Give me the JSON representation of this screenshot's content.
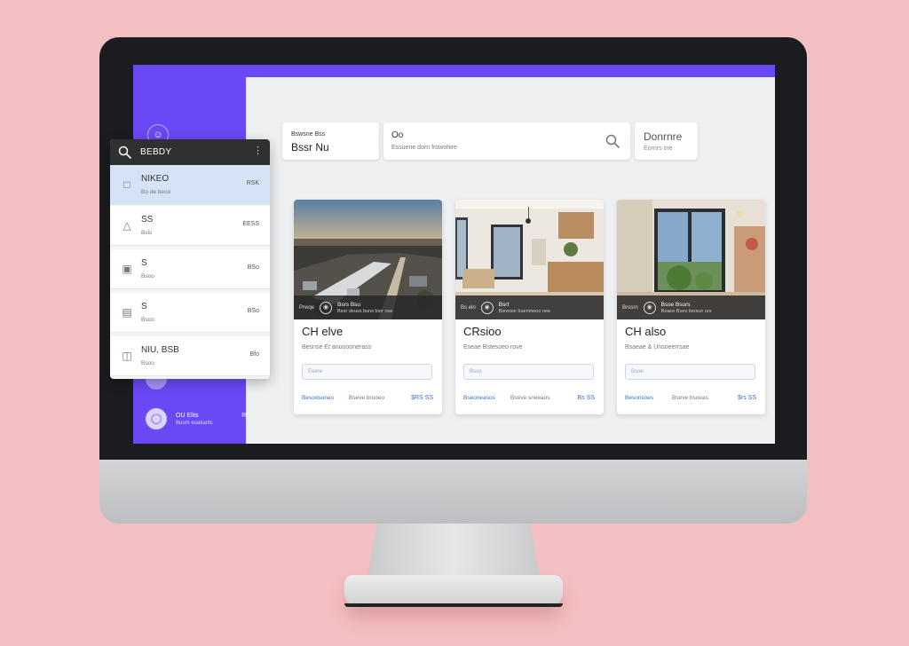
{
  "sidebar": {
    "top_icon": "user-circle-icon",
    "users": [
      {
        "name": "",
        "subtitle": "",
        "count": ""
      },
      {
        "name": "OU Elits",
        "subtitle": "Buum eoatiartls",
        "count": "RS"
      }
    ]
  },
  "search_bar": {
    "location_label": "Bswsne Bss",
    "location_value": "Bssr Nu",
    "query_label": "Oo",
    "query_placeholder": "Essuene dorn frowohire",
    "button_label": "Donrnre",
    "button_sub": "Eornrs ore"
  },
  "cards": [
    {
      "tag": "Prwqe",
      "address_line1": "Bsrs Bsu",
      "address_line2": "Besr deuss buns bsrr ose",
      "title": "CH elve",
      "subtitle": "Besrise Et anoooonerass",
      "field_placeholder": "Eeere",
      "link1": "Besoosuneo",
      "link2": "Bseve bruoeo",
      "price": "$RS SS",
      "scene": "aerial-city"
    },
    {
      "tag": "Bs elo",
      "address_line1": "Bsrt",
      "address_line2": "Bsreose buenmeoo oee",
      "title": "CRsioo",
      "subtitle": "Eseae Bstesoeo rove",
      "field_placeholder": "Bsoe",
      "link1": "Bseoneasos",
      "link2": "Bseve sneeaos",
      "price": "Bs SS",
      "scene": "kitchen-interior"
    },
    {
      "tag": "Brosrn",
      "address_line1": "Bsse Bsurs",
      "address_line2": "Bsaee Bues bsrsuo urs",
      "title": "CH also",
      "subtitle": "Bsaeae & Unsoeerrsae",
      "field_placeholder": "Bsoe",
      "link1": "Besonsoes",
      "link2": "Bseve bsoeas",
      "price": "$rs SS",
      "scene": "living-room"
    }
  ],
  "dropdown": {
    "title": "BEBDY",
    "items": [
      {
        "name": "NIKEO",
        "desc": "Bo de beoo",
        "count": "RSK",
        "icon": "bottle-icon"
      },
      {
        "name": "SS",
        "desc": "Bsls",
        "count": "EESS",
        "icon": "flask-icon"
      },
      {
        "name": "S",
        "desc": "Bsoo",
        "count": "BSo",
        "icon": "box-icon"
      },
      {
        "name": "S",
        "desc": "Bsoo",
        "count": "BSo",
        "icon": "bag-icon"
      },
      {
        "name": "NIU, BSB",
        "desc": "Bsoo",
        "count": "Bfo",
        "icon": "book-icon"
      }
    ]
  },
  "colors": {
    "page_bg": "#f4bfc2",
    "screen_accent": "#6a48f4",
    "link_blue": "#3b6fd1"
  }
}
